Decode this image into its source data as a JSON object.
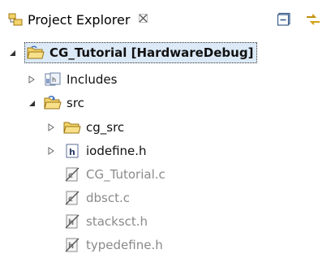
{
  "view": {
    "tab_title": "Project Explorer",
    "tab_icon": "project-explorer-icon",
    "close_icon": "close-icon",
    "tools": [
      {
        "name": "collapse-all-icon"
      },
      {
        "name": "link-with-editor-icon"
      }
    ]
  },
  "tree": {
    "project": {
      "label": "CG_Tutorial [HardwareDebug]",
      "expanded": true,
      "icon": "project-folder-icon"
    },
    "includes": {
      "label": "Includes",
      "expanded": false,
      "icon": "includes-icon"
    },
    "src": {
      "label": "src",
      "expanded": true,
      "icon": "source-folder-icon"
    },
    "cg_src": {
      "label": "cg_src",
      "expanded": false,
      "icon": "folder-icon"
    },
    "iodefine": {
      "label": "iodefine.h",
      "expanded": false,
      "icon": "header-file-icon"
    },
    "files": [
      {
        "label": "CG_Tutorial.c",
        "icon": "c-file-excluded-icon"
      },
      {
        "label": "dbsct.c",
        "icon": "c-file-excluded-icon"
      },
      {
        "label": "stacksct.h",
        "icon": "h-file-excluded-icon"
      },
      {
        "label": "typedefine.h",
        "icon": "h-file-excluded-icon"
      }
    ]
  },
  "colors": {
    "selection_bg": "#dceaf8",
    "folder_yellow": "#f2c94c",
    "excluded_text": "#8a8a8a"
  }
}
